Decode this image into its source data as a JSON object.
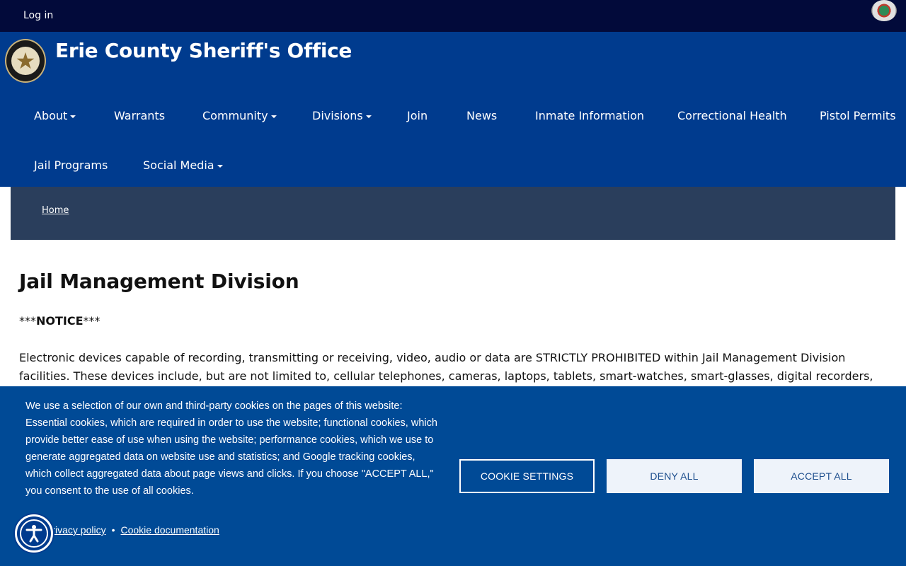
{
  "topbar": {
    "login_label": "Log in"
  },
  "header": {
    "site_title": "Erie County Sheriff's Office",
    "nav": [
      {
        "label": "About",
        "has_dropdown": true
      },
      {
        "label": "Warrants",
        "has_dropdown": false
      },
      {
        "label": "Community",
        "has_dropdown": true
      },
      {
        "label": "Divisions",
        "has_dropdown": true
      },
      {
        "label": "Join",
        "has_dropdown": false
      },
      {
        "label": "News",
        "has_dropdown": false
      },
      {
        "label": "Inmate Information",
        "has_dropdown": false
      },
      {
        "label": "Correctional Health",
        "has_dropdown": false
      },
      {
        "label": "Pistol Permits",
        "has_dropdown": false
      },
      {
        "label": "Jail Programs",
        "has_dropdown": false
      },
      {
        "label": "Social Media",
        "has_dropdown": true
      }
    ]
  },
  "breadcrumb": {
    "home_label": "Home"
  },
  "main": {
    "title": "Jail Management Division",
    "notice_prefix": "***",
    "notice_bold": "NOTICE",
    "notice_suffix": "***",
    "body": "Electronic devices capable of recording, transmitting or receiving, video, audio or data are STRICTLY PROHIBITED within Jail Management Division facilities.   These devices include, but are not limited to, cellular telephones, cameras, laptops, tablets, smart-watches, smart-glasses, digital recorders,"
  },
  "cookie_banner": {
    "text": "We use a selection of our own and third-party cookies on the pages of this website: Essential cookies, which are required in order to use the website; functional cookies, which provide better ease of use when using the website; performance cookies, which we use to generate aggregated data on website use and statistics; and Google tracking cookies, which collect aggregated data about page views and clicks. If you choose \"ACCEPT ALL,\" you consent to the use of all cookies.",
    "privacy_link": "Privacy policy",
    "separator": "•",
    "cookie_doc_link": "Cookie documentation",
    "settings_label": "COOKIE SETTINGS",
    "deny_label": "DENY ALL",
    "accept_label": "ACCEPT ALL"
  },
  "icons": {
    "accessibility": "accessibility-icon",
    "logo": "sheriff-badge-icon",
    "seal": "county-seal-icon"
  },
  "colors": {
    "topbar": "#020a3a",
    "header": "#003b8e",
    "breadcrumb": "#2a3e5c",
    "cookie_banner": "#004a96"
  }
}
